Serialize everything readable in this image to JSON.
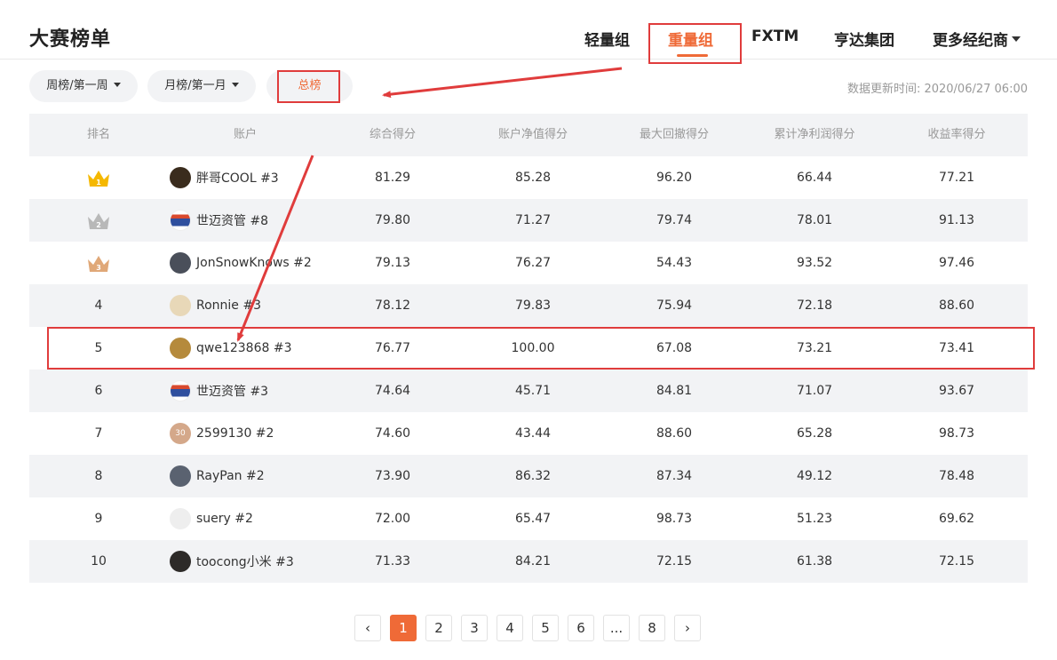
{
  "page": {
    "title": "大赛榜单",
    "updated": "数据更新时间: 2020/06/27 06:00"
  },
  "nav": [
    {
      "label": "轻量组",
      "active": false
    },
    {
      "label": "重量组",
      "active": true
    },
    {
      "label": "FXTM",
      "active": false
    },
    {
      "label": "亨达集团",
      "active": false
    },
    {
      "label": "更多经纪商",
      "active": false
    }
  ],
  "filters": {
    "weekly": "周榜/第一周",
    "monthly": "月榜/第一月",
    "total": "总榜"
  },
  "table": {
    "headers": [
      "排名",
      "账户",
      "综合得分",
      "账户净值得分",
      "最大回撤得分",
      "累计净利润得分",
      "收益率得分"
    ],
    "rows": [
      {
        "rank": "1",
        "account": "胖哥COOL #3",
        "scores": [
          "81.29",
          "85.28",
          "96.20",
          "66.44",
          "77.21"
        ],
        "avatar": "#3a2c1d"
      },
      {
        "rank": "2",
        "account": "世迈资管 #8",
        "scores": [
          "79.80",
          "71.27",
          "79.74",
          "78.01",
          "91.13"
        ],
        "avatar": "#ffffff"
      },
      {
        "rank": "3",
        "account": "JonSnowKnows #2",
        "scores": [
          "79.13",
          "76.27",
          "54.43",
          "93.52",
          "97.46"
        ],
        "avatar": "#4a4f5a"
      },
      {
        "rank": "4",
        "account": "Ronnie #3",
        "scores": [
          "78.12",
          "79.83",
          "75.94",
          "72.18",
          "88.60"
        ],
        "avatar": "#e8d8b8"
      },
      {
        "rank": "5",
        "account": "qwe123868 #3",
        "scores": [
          "76.77",
          "100.00",
          "67.08",
          "73.21",
          "73.41"
        ],
        "avatar": "#b58a3c"
      },
      {
        "rank": "6",
        "account": "世迈资管 #3",
        "scores": [
          "74.64",
          "45.71",
          "84.81",
          "71.07",
          "93.67"
        ],
        "avatar": "#ffffff"
      },
      {
        "rank": "7",
        "account": "2599130 #2",
        "scores": [
          "74.60",
          "43.44",
          "88.60",
          "65.28",
          "98.73"
        ],
        "avatar": "#d4a88a",
        "avatar_text": "30"
      },
      {
        "rank": "8",
        "account": "RayPan #2",
        "scores": [
          "73.90",
          "86.32",
          "87.34",
          "49.12",
          "78.48"
        ],
        "avatar": "#5a6270"
      },
      {
        "rank": "9",
        "account": "suery #2",
        "scores": [
          "72.00",
          "65.47",
          "98.73",
          "51.23",
          "69.62"
        ],
        "avatar": "#eeeeee"
      },
      {
        "rank": "10",
        "account": "toocong小米 #3",
        "scores": [
          "71.33",
          "84.21",
          "72.15",
          "61.38",
          "72.15"
        ],
        "avatar": "#2d2a28"
      }
    ]
  },
  "pagination": {
    "prev": "‹",
    "pages": [
      "1",
      "2",
      "3",
      "4",
      "5",
      "6",
      "...",
      "8"
    ],
    "current": "1",
    "next": "›"
  },
  "colors": {
    "accent": "#ef6a37",
    "annotation": "#e03c3c",
    "gold": "#f5b800",
    "silver": "#b8b8b8",
    "bronze": "#e0a878"
  }
}
